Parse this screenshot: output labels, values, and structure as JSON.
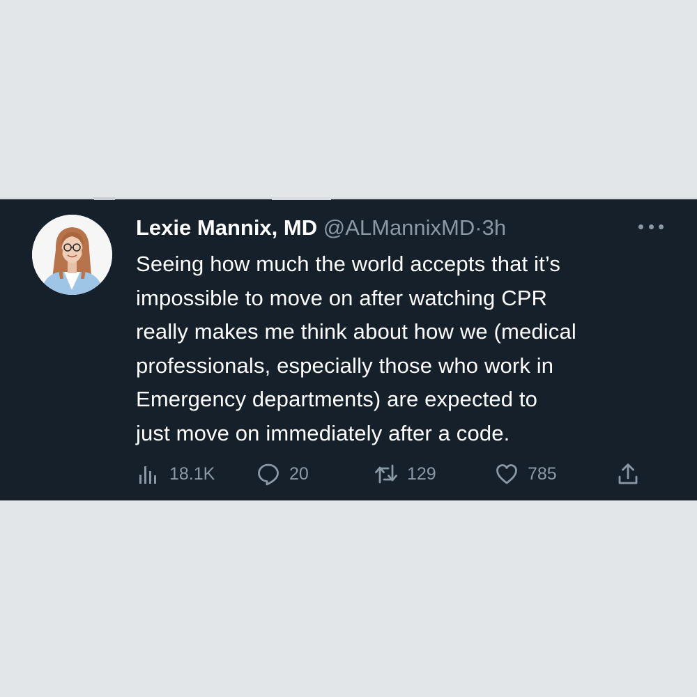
{
  "tweet": {
    "author_name": "Lexie Mannix, MD",
    "handle": "@ALMannixMD",
    "separator": "·",
    "time": "3h",
    "text_lines": [
      "Seeing how much the world accepts that it’s",
      "impossible to move on after watching CPR",
      "really makes me think about how we (medical",
      "professionals, especially those who work in",
      "Emergency departments) are expected to",
      "just move on immediately after a code."
    ],
    "stats": {
      "views": "18.1K",
      "replies": "20",
      "retweets": "129",
      "likes": "785"
    }
  },
  "colors": {
    "card_background": "#15202b",
    "page_background": "#e3e6e9",
    "text_primary": "#ffffff",
    "text_secondary": "#8b98a5"
  },
  "icons": [
    "more-icon",
    "views-icon",
    "reply-icon",
    "retweet-icon",
    "like-icon",
    "share-icon"
  ]
}
